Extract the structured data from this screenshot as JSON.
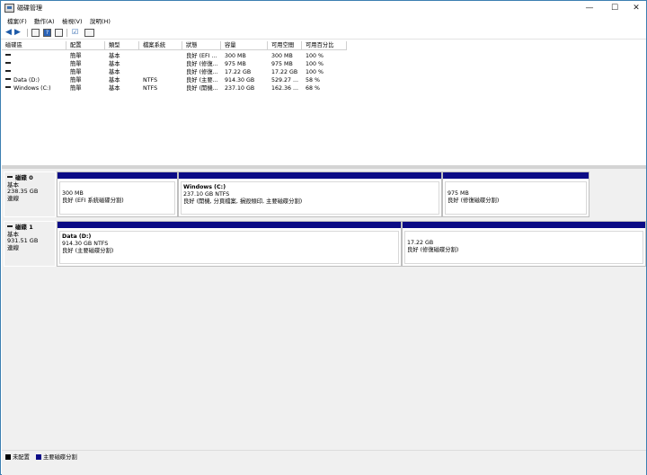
{
  "window": {
    "title": "磁碟管理",
    "controls": {
      "minimize": "—",
      "maximize": "☐",
      "close": "✕"
    }
  },
  "menu": [
    "檔案(F)",
    "動作(A)",
    "檢視(V)",
    "說明(H)"
  ],
  "toolbar": {
    "icons": [
      "back-arrow-icon",
      "forward-arrow-icon",
      "properties-icon",
      "help-icon",
      "help-book-icon",
      "rescan-icon",
      "settings-icon"
    ],
    "help_glyph": "?"
  },
  "volume_table": {
    "columns": [
      "磁碟區",
      "配置",
      "類型",
      "檔案系統",
      "狀態",
      "容量",
      "可用空間",
      "可用百分比"
    ],
    "rows": [
      {
        "volume": "",
        "layout": "簡單",
        "type": "基本",
        "fs": "",
        "status": "良好 (EFI ...",
        "capacity": "300 MB",
        "free": "300 MB",
        "pct": "100 %"
      },
      {
        "volume": "",
        "layout": "簡單",
        "type": "基本",
        "fs": "",
        "status": "良好 (修復...",
        "capacity": "975 MB",
        "free": "975 MB",
        "pct": "100 %"
      },
      {
        "volume": "",
        "layout": "簡單",
        "type": "基本",
        "fs": "",
        "status": "良好 (修復...",
        "capacity": "17.22 GB",
        "free": "17.22 GB",
        "pct": "100 %"
      },
      {
        "volume": "Data (D:)",
        "layout": "簡單",
        "type": "基本",
        "fs": "NTFS",
        "status": "良好 (主要...",
        "capacity": "914.30 GB",
        "free": "529.27 ...",
        "pct": "58 %"
      },
      {
        "volume": "Windows (C:)",
        "layout": "簡單",
        "type": "基本",
        "fs": "NTFS",
        "status": "良好 (開機...",
        "capacity": "237.10 GB",
        "free": "162.36 ...",
        "pct": "68 %"
      }
    ]
  },
  "disks": [
    {
      "name": "磁碟 0",
      "type": "基本",
      "size": "238.35 GB",
      "status": "連線",
      "partitions": [
        {
          "name": "",
          "size": "300 MB",
          "status": "良好 (EFI 系統磁碟分割)"
        },
        {
          "name": "Windows (C:)",
          "size": "237.10 GB NTFS",
          "status": "良好 (開機, 分頁檔案, 損毀傾印, 主要磁碟分割)"
        },
        {
          "name": "",
          "size": "975 MB",
          "status": "良好 (修復磁碟分割)"
        }
      ]
    },
    {
      "name": "磁碟 1",
      "type": "基本",
      "size": "931.51 GB",
      "status": "連線",
      "partitions": [
        {
          "name": "Data (D:)",
          "size": "914.30 GB NTFS",
          "status": "良好 (主要磁碟分割)"
        },
        {
          "name": "",
          "size": "17.22 GB",
          "status": "良好 (修復磁碟分割)"
        }
      ]
    }
  ],
  "legend": [
    {
      "label": "未配置",
      "color": "#000000"
    },
    {
      "label": "主要磁碟分割",
      "color": "#0c0c86"
    }
  ]
}
